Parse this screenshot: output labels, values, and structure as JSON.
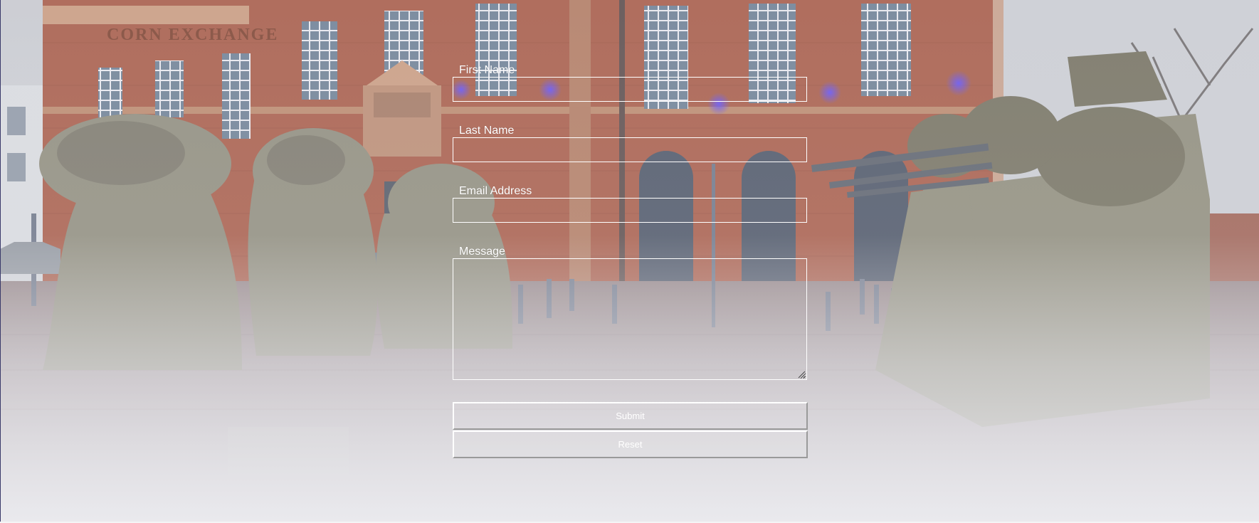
{
  "contact_form": {
    "first_name": {
      "label": "First Name",
      "value": ""
    },
    "last_name": {
      "label": "Last Name",
      "value": ""
    },
    "email": {
      "label": "Email Address",
      "value": ""
    },
    "message": {
      "label": "Message",
      "value": ""
    },
    "submit_label": "Submit",
    "reset_label": "Reset"
  },
  "background": {
    "sign_text": "CORN EXCHANGE",
    "brick_color": "#a05a4a",
    "fade_color": "#e8e8ec"
  }
}
